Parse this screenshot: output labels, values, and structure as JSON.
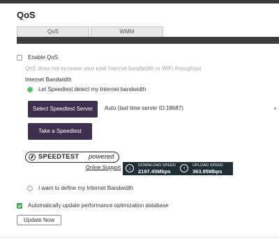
{
  "page": {
    "title": "QoS"
  },
  "tabs": [
    {
      "label": "QoS"
    },
    {
      "label": "WMM"
    }
  ],
  "enable_qos": {
    "label": "Enable QoS",
    "checked": false
  },
  "hint": "QoS does not increase your total Internet bandwidth or WiFi throughput",
  "bandwidth": {
    "heading": "Internet Bandwidth",
    "option_speedtest": {
      "label": "Let Speedtest detect my Internet bandwidth",
      "selected": true
    },
    "option_manual": {
      "label": "I want to define my Internet Bandwidth",
      "selected": false
    }
  },
  "speedtest": {
    "select_server_button": "Select Speedtest Server",
    "server_value": "Auto (last time server ID:18687)",
    "take_test_button": "Take a Speedtest",
    "logo_word": "SPEEDTEST",
    "logo_powered": "powered",
    "online_support_link": "Online Support",
    "download_label": "DOWNLOAD SPEED",
    "download_value": "2197.45Mbps",
    "upload_label": "UPLOAD SPEED",
    "upload_value": "363.95Mbps"
  },
  "auto_update": {
    "label": "Automatically update performance optimization database",
    "checked": true
  },
  "update_button": "Update Now",
  "colors": {
    "button_dark": "#3d2f4d",
    "accent_green": "#4caf50",
    "result_bg": "#1f2e37",
    "top_bar": "#3a3a3a"
  },
  "icons": {
    "download": "arrow-down-circle-icon",
    "upload": "arrow-up-circle-icon",
    "dropdown": "chevron-down-icon"
  }
}
